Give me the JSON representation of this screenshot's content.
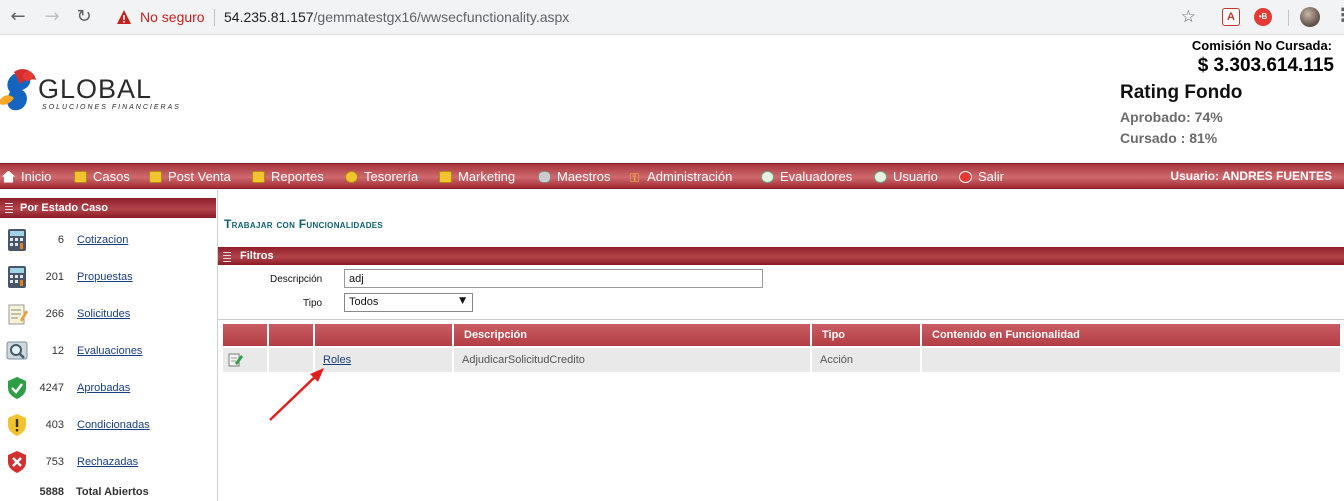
{
  "browser": {
    "security_label": "No seguro",
    "url_host": "54.235.81.157",
    "url_path": "/gemmatestgx16/wwsecfunctionality.aspx"
  },
  "header": {
    "logo_text": "GLOBAL",
    "logo_subtitle": "SOLUCIONES FINANCIERAS",
    "comision_label": "Comisión No Cursada:",
    "comision_value": "$ 3.303.614.115",
    "rating_title": "Rating Fondo",
    "aprobado": "Aprobado: 74%",
    "cursado": "Cursado : 81%"
  },
  "menu": {
    "items": [
      {
        "label": "Inicio",
        "icon": "home-icon"
      },
      {
        "label": "Casos",
        "icon": "folder-icon"
      },
      {
        "label": "Post Venta",
        "icon": "folder-icon"
      },
      {
        "label": "Reportes",
        "icon": "folder-icon"
      },
      {
        "label": "Tesorería",
        "icon": "coin-icon"
      },
      {
        "label": "Marketing",
        "icon": "folder-icon"
      },
      {
        "label": "Maestros",
        "icon": "database-icon"
      },
      {
        "label": "Administración",
        "icon": "key-icon"
      },
      {
        "label": "Evaluadores",
        "icon": "user-icon"
      },
      {
        "label": "Usuario",
        "icon": "user-icon"
      },
      {
        "label": "Salir",
        "icon": "exit-icon"
      }
    ],
    "usuario": "Usuario:  ANDRES FUENTES"
  },
  "sidebar": {
    "title": "Por Estado Caso",
    "items": [
      {
        "count": "6",
        "label": "Cotizacion",
        "icon": "calculator-icon"
      },
      {
        "count": "201",
        "label": "Propuestas",
        "icon": "calculator-icon"
      },
      {
        "count": "266",
        "label": "Solicitudes",
        "icon": "notepad-icon"
      },
      {
        "count": "12",
        "label": "Evaluaciones",
        "icon": "magnifier-icon"
      },
      {
        "count": "4247",
        "label": "Aprobadas",
        "icon": "shield-check-icon"
      },
      {
        "count": "403",
        "label": "Condicionadas",
        "icon": "shield-warning-icon"
      },
      {
        "count": "753",
        "label": "Rechazadas",
        "icon": "shield-x-icon"
      }
    ],
    "total_count": "5888",
    "total_label": "Total Abiertos"
  },
  "main": {
    "title": "Trabajar con Funcionalidades",
    "filtros": {
      "title": "Filtros",
      "descripcion_label": "Descripción",
      "descripcion_value": "adj",
      "tipo_label": "Tipo",
      "tipo_value": "Todos"
    },
    "grid": {
      "headers": [
        "",
        "",
        "",
        "Descripción",
        "Tipo",
        "Contenido en Funcionalidad"
      ],
      "rows": [
        {
          "link": "Roles",
          "descripcion": "AdjudicarSolicitudCredito",
          "tipo": "Acción",
          "contenido": ""
        }
      ]
    }
  },
  "colors": {
    "menu_red": "#b3434b",
    "title_teal": "#0f5f6e",
    "link_blue": "#1a3e7a",
    "annotation_arrow": "#e0201f"
  }
}
